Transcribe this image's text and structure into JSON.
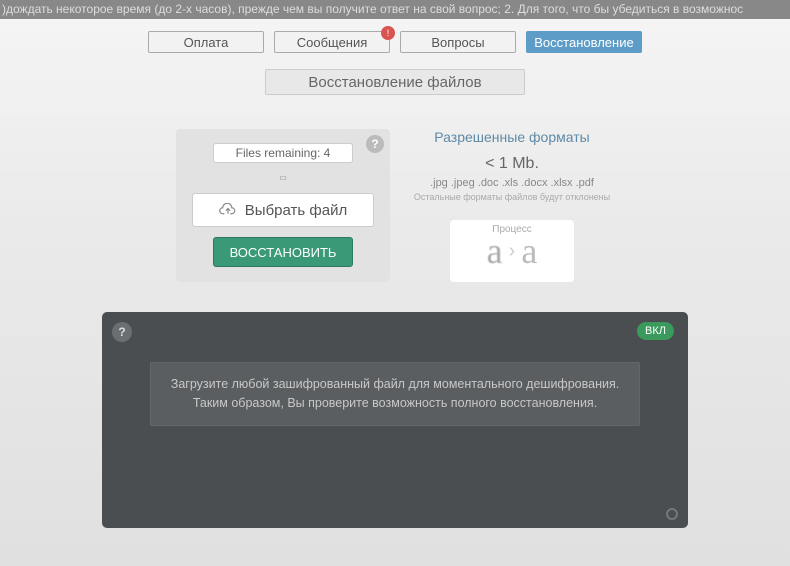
{
  "top_text": ")дождать некоторое время (до 2-х часов), прежде чем вы получите ответ на свой вопрос; 2. Для того, что бы убедиться в возможнос",
  "tabs": {
    "payment": "Оплата",
    "messages": "Сообщения",
    "messages_badge": "!",
    "questions": "Вопросы",
    "restore": "Восстановление"
  },
  "page_title": "Восстановление файлов",
  "upload": {
    "remaining": "Files remaining: 4",
    "choose": "Выбрать файл",
    "restore_btn": "ВОССТАНОВИТЬ",
    "help": "?"
  },
  "formats": {
    "title": "Разрешенные форматы",
    "size": "< 1 Mb.",
    "ext": ".jpg .jpeg .doc .xls .docx .xlsx .pdf",
    "note": "Остальные форматы файлов будут отклонены",
    "process_label": "Процесс",
    "glyph_before": "a",
    "glyph_after": "a",
    "arrow": "›"
  },
  "console": {
    "help": "?",
    "toggle": "ВКЛ",
    "msg_line1": "Загрузите любой зашифрованный файл для моментального дешифрования.",
    "msg_line2": "Таким образом, Вы проверите возможность полного восстановления."
  }
}
